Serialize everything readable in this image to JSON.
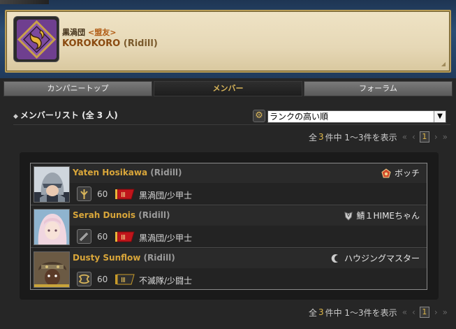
{
  "free_company": {
    "name": "黒渦団",
    "rank": "<盟友>",
    "player_name": "KOROKORO",
    "player_world": "(Ridill)"
  },
  "tabs": [
    {
      "label": "カンパニートップ",
      "active": false
    },
    {
      "label": "メンバー",
      "active": true
    },
    {
      "label": "フォーラム",
      "active": false
    }
  ],
  "list": {
    "title": "メンバーリスト (全 3 人)",
    "sort_selected": "ランクの高い順"
  },
  "pager": {
    "prefix": "全",
    "total": "3",
    "middle": "件中 1～3件を表示",
    "page": "1"
  },
  "members": [
    {
      "name": "Yaten Hosikawa",
      "world": "(Ridill)",
      "rank": "ボッチ",
      "level": "60",
      "gc": "黒渦団/少甲士",
      "gc_color": "#c0151b",
      "rank_color": "#d14a2b"
    },
    {
      "name": "Serah Dunois",
      "world": "(Ridill)",
      "rank": "鯖１HIMEちゃん",
      "level": "60",
      "gc": "黒渦団/少甲士",
      "gc_color": "#c0151b",
      "rank_color": "#bbbbbb"
    },
    {
      "name": "Dusty Sunflow",
      "world": "(Ridill)",
      "rank": "ハウジングマスター",
      "level": "60",
      "gc": "不滅隊/少闘士",
      "gc_color": "#c89b2a",
      "rank_color": "#cccccc"
    }
  ],
  "accent_color": "#d9a63a"
}
